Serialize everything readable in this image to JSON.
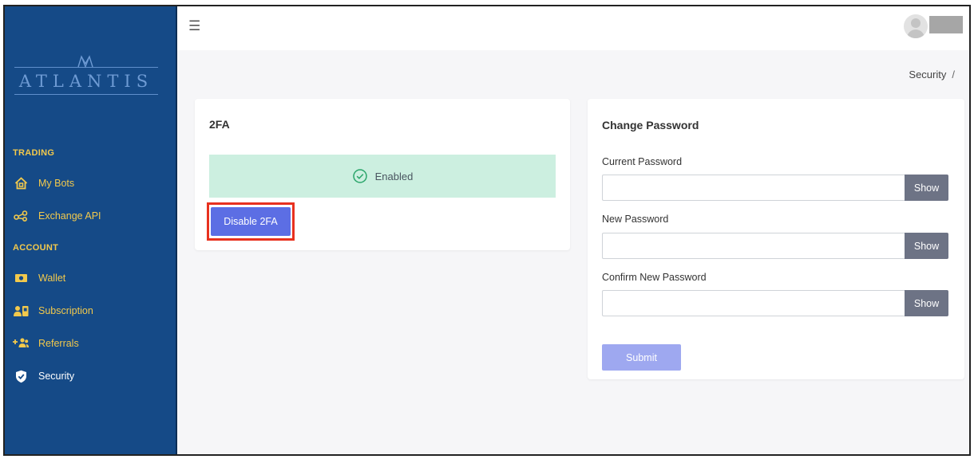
{
  "app": {
    "logo_text": "ATLANTIS",
    "brand_color": "#154a87",
    "accent_color": "#f2c94c"
  },
  "sidebar": {
    "sections": [
      {
        "label": "TRADING",
        "items": [
          {
            "label": "My Bots",
            "icon": "home-icon"
          },
          {
            "label": "Exchange API",
            "icon": "share-icon"
          }
        ]
      },
      {
        "label": "ACCOUNT",
        "items": [
          {
            "label": "Wallet",
            "icon": "wallet-icon"
          },
          {
            "label": "Subscription",
            "icon": "subscription-icon"
          },
          {
            "label": "Referrals",
            "icon": "add-users-icon"
          },
          {
            "label": "Security",
            "icon": "shield-icon",
            "active": true
          }
        ]
      }
    ]
  },
  "topbar": {
    "menu_icon": "hamburger-icon",
    "avatar_icon": "user-avatar-icon"
  },
  "breadcrumb": {
    "current": "Security",
    "separator": "/"
  },
  "twofa": {
    "title": "2FA",
    "status": "Enabled",
    "status_icon": "check-circle-icon",
    "status_color": "#ccefe0",
    "disable_label": "Disable 2FA"
  },
  "password": {
    "title": "Change Password",
    "fields": [
      {
        "label": "Current Password",
        "value": "",
        "show_label": "Show"
      },
      {
        "label": "New Password",
        "value": "",
        "show_label": "Show"
      },
      {
        "label": "Confirm New Password",
        "value": "",
        "show_label": "Show"
      }
    ],
    "submit_label": "Submit"
  }
}
